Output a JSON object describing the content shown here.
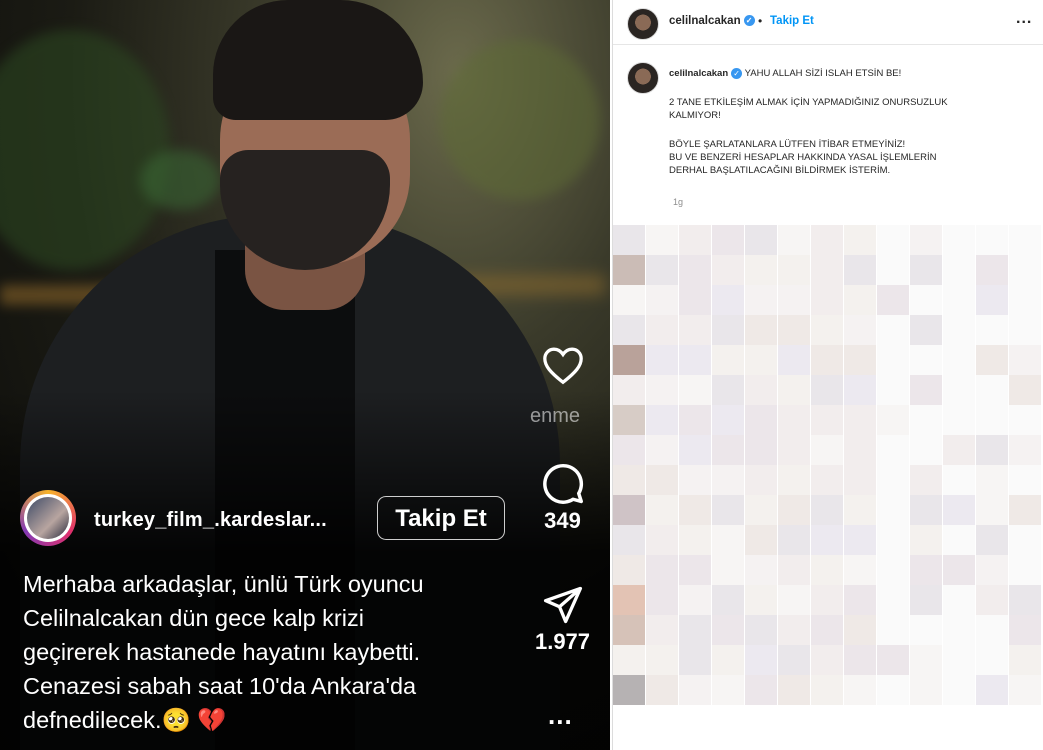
{
  "reel": {
    "username": "turkey_film_.kardeslar...",
    "follow_label": "Takip Et",
    "ghost_text": "enme",
    "caption_lines": [
      "Merhaba arkadaşlar, ünlü Türk oyuncu",
      "Celilnalcakan dün gece kalp krizi",
      "geçirerek hastanede hayatını kaybetti.",
      "Cenazesi sabah saat 10'da Ankara'da",
      "defnedilecek.🥺 💔"
    ],
    "actions": {
      "like_icon": "heart-icon",
      "comment_icon": "comment-icon",
      "comment_count": "349",
      "share_icon": "send-icon",
      "share_count": "1.977",
      "more_label": "..."
    }
  },
  "post": {
    "username": "celilnalcakan",
    "separator": "•",
    "follow_label": "Takip Et",
    "menu_label": "...",
    "caption_username": "celilnalcakan",
    "caption_lines": [
      "YAHU ALLAH SİZİ ISLAH ETSİN BE!",
      "",
      "2 TANE ETKİLEŞİM ALMAK İÇİN YAPMADIĞINIZ ONURSUZLUK",
      "KALMIYOR!",
      "",
      "BÖYLE ŞARLATANLARA LÜTFEN İTİBAR ETMEYİNİZ!",
      "BU VE BENZERİ HESAPLAR HAKKINDA YASAL İŞLEMLERİN",
      "DERHAL BAŞLATILACAĞINI BİLDİRMEK İSTERİM."
    ],
    "age": "1g"
  },
  "colors": {
    "link_blue": "#0095f6",
    "verified_blue": "#3897f0",
    "text_dark": "#262626",
    "muted": "#8e8e8e"
  }
}
